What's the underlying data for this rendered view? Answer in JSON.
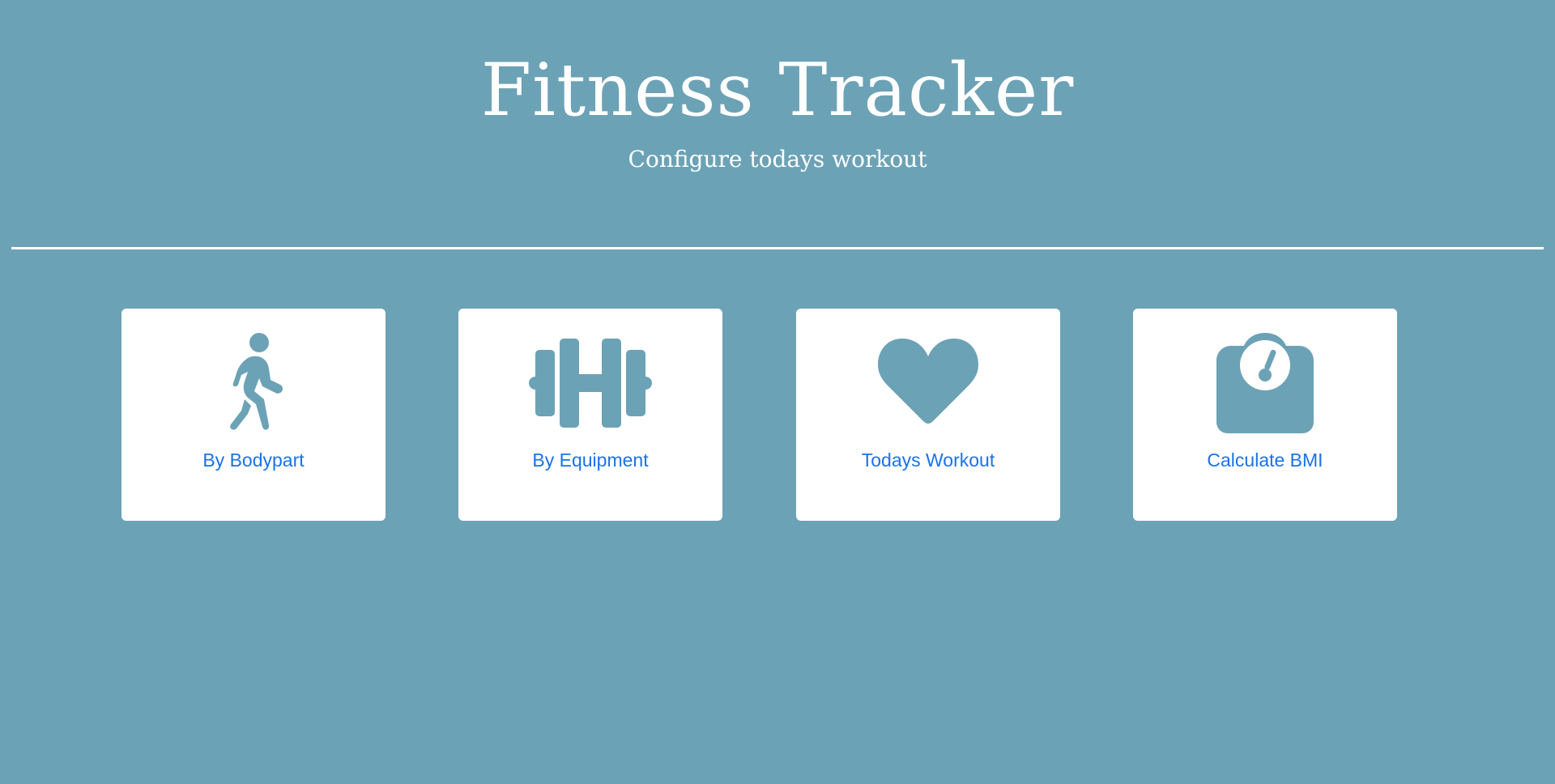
{
  "header": {
    "title": "Fitness Tracker",
    "subtitle": "Configure todays workout"
  },
  "colors": {
    "background": "#6ca2b6",
    "card": "#ffffff",
    "icon": "#6ca2b6",
    "link": "#1a73e8"
  },
  "cards": [
    {
      "label": "By Bodypart",
      "icon": "walking-person-icon"
    },
    {
      "label": "By Equipment",
      "icon": "dumbbell-icon"
    },
    {
      "label": "Todays Workout",
      "icon": "heart-icon"
    },
    {
      "label": "Calculate BMI",
      "icon": "weight-scale-icon"
    }
  ]
}
